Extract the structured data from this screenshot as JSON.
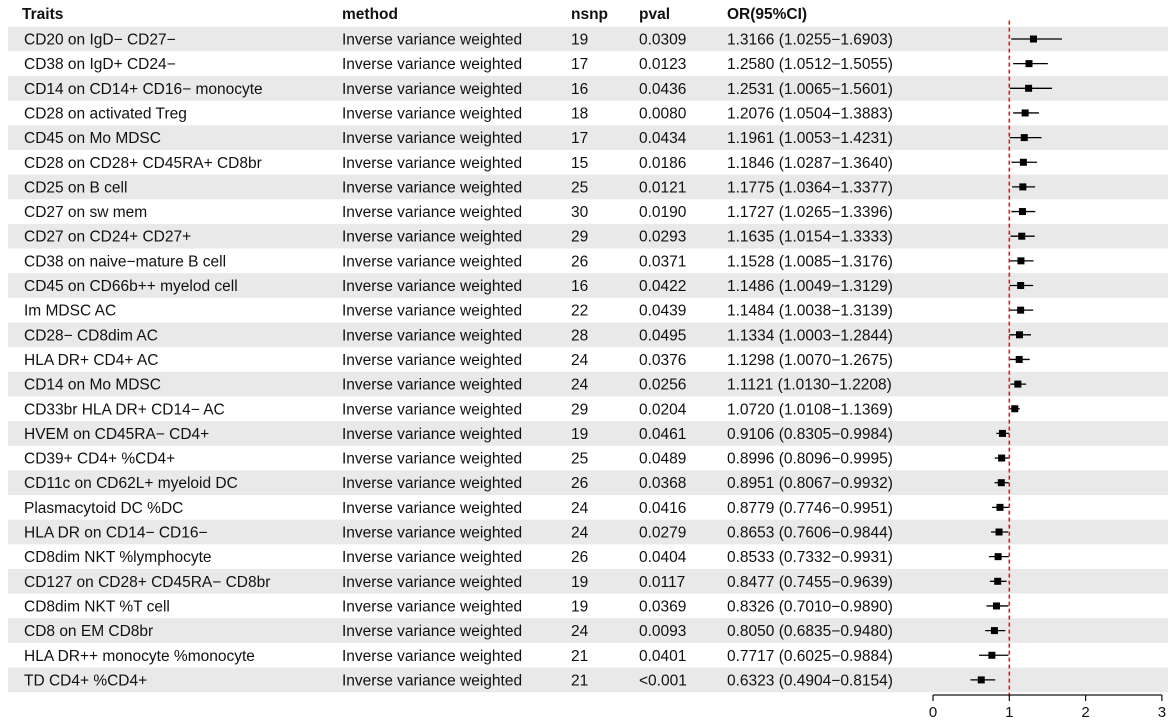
{
  "chart_data": {
    "type": "forest",
    "columns": {
      "trait": "Traits",
      "method": "method",
      "nsnp": "nsnp",
      "pval": "pval",
      "or": "OR(95%CI)"
    },
    "x_ticks": [
      0,
      1,
      2,
      3
    ],
    "xlim": [
      0,
      3
    ],
    "reference_line": 1,
    "colors": {
      "reference_line": "#e41a1c",
      "point": "#000000",
      "shade": "#e9e9e9"
    },
    "rows": [
      {
        "trait": "CD20 on IgD− CD27−",
        "method": "Inverse variance weighted",
        "nsnp": "19",
        "pval": "0.0309",
        "or_text": "1.3166 (1.0255−1.6903)",
        "or": 1.3166,
        "lo": 1.0255,
        "hi": 1.6903
      },
      {
        "trait": "CD38 on IgD+ CD24−",
        "method": "Inverse variance weighted",
        "nsnp": "17",
        "pval": "0.0123",
        "or_text": "1.2580 (1.0512−1.5055)",
        "or": 1.258,
        "lo": 1.0512,
        "hi": 1.5055
      },
      {
        "trait": "CD14 on CD14+ CD16− monocyte",
        "method": "Inverse variance weighted",
        "nsnp": "16",
        "pval": "0.0436",
        "or_text": "1.2531 (1.0065−1.5601)",
        "or": 1.2531,
        "lo": 1.0065,
        "hi": 1.5601
      },
      {
        "trait": "CD28 on activated Treg",
        "method": "Inverse variance weighted",
        "nsnp": "18",
        "pval": "0.0080",
        "or_text": "1.2076 (1.0504−1.3883)",
        "or": 1.2076,
        "lo": 1.0504,
        "hi": 1.3883
      },
      {
        "trait": "CD45 on Mo MDSC",
        "method": "Inverse variance weighted",
        "nsnp": "17",
        "pval": "0.0434",
        "or_text": "1.1961 (1.0053−1.4231)",
        "or": 1.1961,
        "lo": 1.0053,
        "hi": 1.4231
      },
      {
        "trait": "CD28 on CD28+ CD45RA+ CD8br",
        "method": "Inverse variance weighted",
        "nsnp": "15",
        "pval": "0.0186",
        "or_text": "1.1846 (1.0287−1.3640)",
        "or": 1.1846,
        "lo": 1.0287,
        "hi": 1.364
      },
      {
        "trait": "CD25 on B cell",
        "method": "Inverse variance weighted",
        "nsnp": "25",
        "pval": "0.0121",
        "or_text": "1.1775 (1.0364−1.3377)",
        "or": 1.1775,
        "lo": 1.0364,
        "hi": 1.3377
      },
      {
        "trait": "CD27 on sw mem",
        "method": "Inverse variance weighted",
        "nsnp": "30",
        "pval": "0.0190",
        "or_text": "1.1727 (1.0265−1.3396)",
        "or": 1.1727,
        "lo": 1.0265,
        "hi": 1.3396
      },
      {
        "trait": "CD27 on CD24+ CD27+",
        "method": "Inverse variance weighted",
        "nsnp": "29",
        "pval": "0.0293",
        "or_text": "1.1635 (1.0154−1.3333)",
        "or": 1.1635,
        "lo": 1.0154,
        "hi": 1.3333
      },
      {
        "trait": "CD38 on naive−mature B cell",
        "method": "Inverse variance weighted",
        "nsnp": "26",
        "pval": "0.0371",
        "or_text": "1.1528 (1.0085−1.3176)",
        "or": 1.1528,
        "lo": 1.0085,
        "hi": 1.3176
      },
      {
        "trait": "CD45 on CD66b++ myelod cell",
        "method": "Inverse variance weighted",
        "nsnp": "16",
        "pval": "0.0422",
        "or_text": "1.1486 (1.0049−1.3129)",
        "or": 1.1486,
        "lo": 1.0049,
        "hi": 1.3129
      },
      {
        "trait": "Im MDSC AC",
        "method": "Inverse variance weighted",
        "nsnp": "22",
        "pval": "0.0439",
        "or_text": "1.1484 (1.0038−1.3139)",
        "or": 1.1484,
        "lo": 1.0038,
        "hi": 1.3139
      },
      {
        "trait": "CD28− CD8dim AC",
        "method": "Inverse variance weighted",
        "nsnp": "28",
        "pval": "0.0495",
        "or_text": "1.1334 (1.0003−1.2844)",
        "or": 1.1334,
        "lo": 1.0003,
        "hi": 1.2844
      },
      {
        "trait": "HLA DR+ CD4+ AC",
        "method": "Inverse variance weighted",
        "nsnp": "24",
        "pval": "0.0376",
        "or_text": "1.1298 (1.0070−1.2675)",
        "or": 1.1298,
        "lo": 1.007,
        "hi": 1.2675
      },
      {
        "trait": "CD14 on Mo MDSC",
        "method": "Inverse variance weighted",
        "nsnp": "24",
        "pval": "0.0256",
        "or_text": "1.1121 (1.0130−1.2208)",
        "or": 1.1121,
        "lo": 1.013,
        "hi": 1.2208
      },
      {
        "trait": "CD33br HLA DR+ CD14− AC",
        "method": "Inverse variance weighted",
        "nsnp": "29",
        "pval": "0.0204",
        "or_text": "1.0720 (1.0108−1.1369)",
        "or": 1.072,
        "lo": 1.0108,
        "hi": 1.1369
      },
      {
        "trait": "HVEM on CD45RA− CD4+",
        "method": "Inverse variance weighted",
        "nsnp": "19",
        "pval": "0.0461",
        "or_text": "0.9106 (0.8305−0.9984)",
        "or": 0.9106,
        "lo": 0.8305,
        "hi": 0.9984
      },
      {
        "trait": "CD39+ CD4+ %CD4+",
        "method": "Inverse variance weighted",
        "nsnp": "25",
        "pval": "0.0489",
        "or_text": "0.8996 (0.8096−0.9995)",
        "or": 0.8996,
        "lo": 0.8096,
        "hi": 0.9995
      },
      {
        "trait": "CD11c on CD62L+ myeloid DC",
        "method": "Inverse variance weighted",
        "nsnp": "26",
        "pval": "0.0368",
        "or_text": "0.8951 (0.8067−0.9932)",
        "or": 0.8951,
        "lo": 0.8067,
        "hi": 0.9932
      },
      {
        "trait": "Plasmacytoid DC %DC",
        "method": "Inverse variance weighted",
        "nsnp": "24",
        "pval": "0.0416",
        "or_text": "0.8779 (0.7746−0.9951)",
        "or": 0.8779,
        "lo": 0.7746,
        "hi": 0.9951
      },
      {
        "trait": "HLA DR on CD14− CD16−",
        "method": "Inverse variance weighted",
        "nsnp": "24",
        "pval": "0.0279",
        "or_text": "0.8653 (0.7606−0.9844)",
        "or": 0.8653,
        "lo": 0.7606,
        "hi": 0.9844
      },
      {
        "trait": "CD8dim NKT %lymphocyte",
        "method": "Inverse variance weighted",
        "nsnp": "26",
        "pval": "0.0404",
        "or_text": "0.8533 (0.7332−0.9931)",
        "or": 0.8533,
        "lo": 0.7332,
        "hi": 0.9931
      },
      {
        "trait": "CD127 on CD28+ CD45RA− CD8br",
        "method": "Inverse variance weighted",
        "nsnp": "19",
        "pval": "0.0117",
        "or_text": "0.8477 (0.7455−0.9639)",
        "or": 0.8477,
        "lo": 0.7455,
        "hi": 0.9639
      },
      {
        "trait": "CD8dim NKT %T cell",
        "method": "Inverse variance weighted",
        "nsnp": "19",
        "pval": "0.0369",
        "or_text": "0.8326 (0.7010−0.9890)",
        "or": 0.8326,
        "lo": 0.701,
        "hi": 0.989
      },
      {
        "trait": "CD8 on EM CD8br",
        "method": "Inverse variance weighted",
        "nsnp": "24",
        "pval": "0.0093",
        "or_text": "0.8050 (0.6835−0.9480)",
        "or": 0.805,
        "lo": 0.6835,
        "hi": 0.948
      },
      {
        "trait": "HLA DR++ monocyte %monocyte",
        "method": "Inverse variance weighted",
        "nsnp": "21",
        "pval": "0.0401",
        "or_text": "0.7717 (0.6025−0.9884)",
        "or": 0.7717,
        "lo": 0.6025,
        "hi": 0.9884
      },
      {
        "trait": "TD CD4+ %CD4+",
        "method": "Inverse variance weighted",
        "nsnp": "21",
        "pval": "<0.001",
        "or_text": "0.6323 (0.4904−0.8154)",
        "or": 0.6323,
        "lo": 0.4904,
        "hi": 0.8154
      }
    ]
  }
}
